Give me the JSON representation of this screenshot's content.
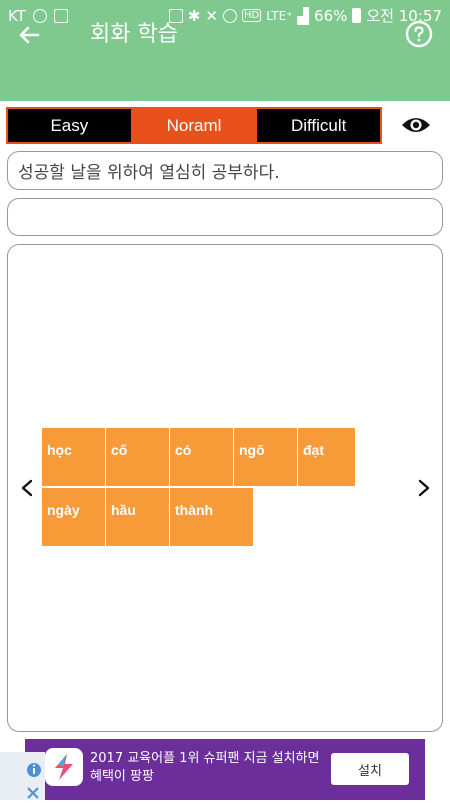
{
  "status_bar": {
    "carrier": "KT",
    "network": "LTE⁺",
    "battery": "66%",
    "time": "오전 10:57"
  },
  "app_bar": {
    "title": "회화 학습",
    "back_icon": "arrow-left-icon",
    "help_icon": "question-circle-icon"
  },
  "levels": [
    {
      "label": "Easy",
      "active": false
    },
    {
      "label": "Noraml",
      "active": true
    },
    {
      "label": "Difficult",
      "active": false
    }
  ],
  "sentence": "성공할 날을 위하여 열심히 공부하다.",
  "answer": "",
  "word_tiles": [
    "học",
    "cố",
    "có",
    "ngõ",
    "đạt",
    "ngày",
    "hầu",
    "thành"
  ],
  "ad": {
    "text": "2017 교육어플 1위 슈퍼팬 지금 설치하면 혜택이 팡팡",
    "install_label": "설치"
  },
  "colors": {
    "primary": "#7fc98f",
    "accent": "#e8501c",
    "tile": "#f79a38",
    "ad_bg": "#6b2e9a"
  }
}
